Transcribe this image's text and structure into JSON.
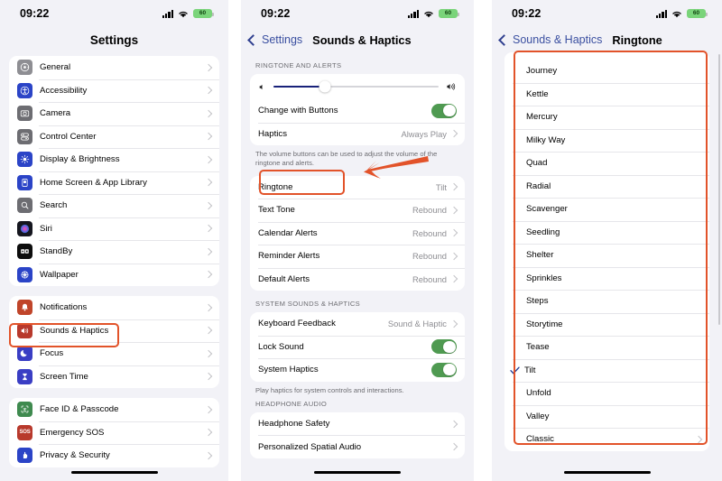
{
  "status_bar": {
    "time": "09:22",
    "battery_level": "60",
    "wifi_icon": "wifi-icon",
    "signal_icon": "cellular-signal-icon"
  },
  "colors": {
    "highlight": "#e2532a",
    "accent_blue": "#3a4fa0",
    "toggle_green": "#4f9a51",
    "slider_fill": "#19227a",
    "page_bg": "#f2f2f7"
  },
  "panel1": {
    "title": "Settings",
    "groups": [
      {
        "rows": [
          {
            "label": "General",
            "icon": "general-gear-icon",
            "icon_color": "#8e8e93",
            "chevron": true
          },
          {
            "label": "Accessibility",
            "icon": "accessibility-icon",
            "icon_color": "#2b44c7",
            "chevron": true
          },
          {
            "label": "Camera",
            "icon": "camera-icon",
            "icon_color": "#6d6d72",
            "chevron": true
          },
          {
            "label": "Control Center",
            "icon": "control-center-icon",
            "icon_color": "#6d6d72",
            "chevron": true
          },
          {
            "label": "Display & Brightness",
            "icon": "display-brightness-icon",
            "icon_color": "#2b44c7",
            "chevron": true
          },
          {
            "label": "Home Screen & App Library",
            "icon": "home-screen-icon",
            "icon_color": "#2b44c7",
            "chevron": true
          },
          {
            "label": "Search",
            "icon": "search-icon",
            "icon_color": "#6d6d72",
            "chevron": true
          },
          {
            "label": "Siri",
            "icon": "siri-icon",
            "icon_color": "#1a1a2e",
            "chevron": true
          },
          {
            "label": "StandBy",
            "icon": "standby-icon",
            "icon_color": "#0d0d0d",
            "chevron": true
          },
          {
            "label": "Wallpaper",
            "icon": "wallpaper-icon",
            "icon_color": "#2b44c7",
            "chevron": true
          }
        ]
      },
      {
        "rows": [
          {
            "label": "Notifications",
            "icon": "notifications-bell-icon",
            "icon_color": "#c0452a",
            "chevron": true
          },
          {
            "label": "Sounds & Haptics",
            "icon": "sounds-haptics-speaker-icon",
            "icon_color": "#b8392c",
            "chevron": true,
            "highlighted": true
          },
          {
            "label": "Focus",
            "icon": "focus-moon-icon",
            "icon_color": "#3a3ec4",
            "chevron": true
          },
          {
            "label": "Screen Time",
            "icon": "screen-time-hourglass-icon",
            "icon_color": "#3a3ec4",
            "chevron": true
          }
        ]
      },
      {
        "rows": [
          {
            "label": "Face ID & Passcode",
            "icon": "face-id-icon",
            "icon_color": "#3f8a4f",
            "chevron": true
          },
          {
            "label": "Emergency SOS",
            "icon": "emergency-sos-icon",
            "icon_color": "#b8392c",
            "chevron": true
          },
          {
            "label": "Privacy & Security",
            "icon": "privacy-security-hand-icon",
            "icon_color": "#2b44c7",
            "chevron": true
          }
        ]
      }
    ]
  },
  "panel2": {
    "back_label": "Settings",
    "title": "Sounds & Haptics",
    "section1_header": "RINGTONE AND ALERTS",
    "slider": {
      "left_icon": "speaker-low-icon",
      "right_icon": "speaker-high-icon",
      "value_percent": 31
    },
    "section1_rows": [
      {
        "label": "Change with Buttons",
        "control": "toggle",
        "toggle_on": true
      },
      {
        "label": "Haptics",
        "value": "Always Play",
        "chevron": true
      }
    ],
    "section1_footer": "The volume buttons can be used to adjust the volume of the ringtone and alerts.",
    "section2_rows": [
      {
        "label": "Ringtone",
        "value": "Tilt",
        "chevron": true,
        "highlighted": true
      },
      {
        "label": "Text Tone",
        "value": "Rebound",
        "chevron": true
      },
      {
        "label": "Calendar Alerts",
        "value": "Rebound",
        "chevron": true
      },
      {
        "label": "Reminder Alerts",
        "value": "Rebound",
        "chevron": true
      },
      {
        "label": "Default Alerts",
        "value": "Rebound",
        "chevron": true
      }
    ],
    "section3_header": "SYSTEM SOUNDS & HAPTICS",
    "section3_rows": [
      {
        "label": "Keyboard Feedback",
        "value": "Sound & Haptic",
        "chevron": true
      },
      {
        "label": "Lock Sound",
        "control": "toggle",
        "toggle_on": true
      },
      {
        "label": "System Haptics",
        "control": "toggle",
        "toggle_on": true
      }
    ],
    "section3_footer": "Play haptics for system controls and interactions.",
    "section4_header": "HEADPHONE AUDIO",
    "section4_rows": [
      {
        "label": "Headphone Safety",
        "chevron": true
      },
      {
        "label": "Personalized Spatial Audio",
        "chevron": true
      }
    ]
  },
  "panel3": {
    "back_label": "Sounds & Haptics",
    "title": "Ringtone",
    "rows": [
      {
        "label": "Journey",
        "selected": false
      },
      {
        "label": "Kettle",
        "selected": false
      },
      {
        "label": "Mercury",
        "selected": false
      },
      {
        "label": "Milky Way",
        "selected": false
      },
      {
        "label": "Quad",
        "selected": false
      },
      {
        "label": "Radial",
        "selected": false
      },
      {
        "label": "Scavenger",
        "selected": false
      },
      {
        "label": "Seedling",
        "selected": false
      },
      {
        "label": "Shelter",
        "selected": false
      },
      {
        "label": "Sprinkles",
        "selected": false
      },
      {
        "label": "Steps",
        "selected": false
      },
      {
        "label": "Storytime",
        "selected": false
      },
      {
        "label": "Tease",
        "selected": false
      },
      {
        "label": "Tilt",
        "selected": true
      },
      {
        "label": "Unfold",
        "selected": false
      },
      {
        "label": "Valley",
        "selected": false
      },
      {
        "label": "Classic",
        "selected": false,
        "chevron": true
      }
    ]
  }
}
